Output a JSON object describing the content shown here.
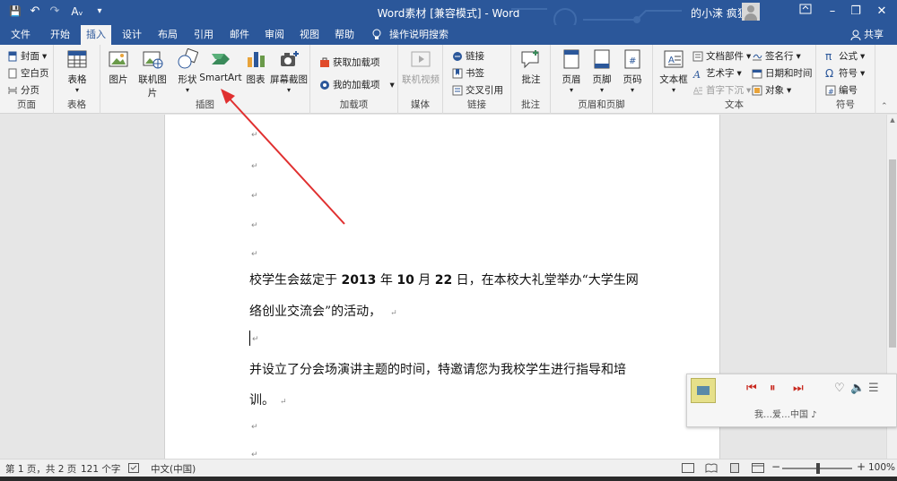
{
  "window": {
    "title": "Word素材 [兼容模式] - Word",
    "user": "的小涞 疯狂",
    "minimize_glyph": "–",
    "restore_glyph": "❐",
    "close_glyph": "✕"
  },
  "qat": {
    "save_glyph": "💾",
    "undo_glyph": "↶",
    "redo_glyph": "↷",
    "format_glyph": "Aᵥ",
    "more_glyph": "▾"
  },
  "tabs": [
    "文件",
    "开始",
    "插入",
    "设计",
    "布局",
    "引用",
    "邮件",
    "审阅",
    "视图",
    "帮助",
    "操作说明搜索"
  ],
  "share": "共享",
  "ribbon": {
    "pages": {
      "label": "页面",
      "cover": "封面",
      "blank": "空白页",
      "break": "分页"
    },
    "tables": {
      "label": "表格",
      "table": "表格"
    },
    "illustrations": {
      "label": "插图",
      "picture": "图片",
      "online_picture": "联机图片",
      "shapes": "形状",
      "smartart": "SmartArt",
      "chart": "图表",
      "screenshot": "屏幕截图"
    },
    "addins": {
      "label": "加载项",
      "get": "获取加载项",
      "mine": "我的加载项"
    },
    "media": {
      "label": "媒体",
      "video": "联机视频"
    },
    "links": {
      "label": "链接",
      "link": "链接",
      "bookmark": "书签",
      "crossref": "交叉引用"
    },
    "comments": {
      "label": "批注",
      "comment": "批注"
    },
    "header_footer": {
      "label": "页眉和页脚",
      "header": "页眉",
      "footer": "页脚",
      "page_number": "页码"
    },
    "text": {
      "label": "文本",
      "textbox": "文本框",
      "quickparts": "文档部件",
      "wordart": "艺术字",
      "dropcap": "首字下沉",
      "signature": "签名行",
      "datetime": "日期和时间",
      "object": "对象"
    },
    "symbols": {
      "label": "符号",
      "equation": "公式",
      "symbol": "符号",
      "number": "编号"
    }
  },
  "document": {
    "paragraph_mark": "↵",
    "line1_a": "校学生会兹定于 ",
    "line1_b": "2013",
    "line1_c": " 年 ",
    "line1_d": "10",
    "line1_e": " 月 ",
    "line1_f": "22",
    "line1_g": " 日，在本校大礼堂举办“大学生网",
    "line2": "络创业交流会”的活动，",
    "line3": "并设立了分会场演讲主题的时间，特邀请您为我校学生进行指导和培",
    "line4": "训。"
  },
  "statusbar": {
    "page": "第 1 页，共 2 页",
    "words": "121 个字",
    "language": "中文(中国)",
    "zoom": "100%",
    "zoom_minus": "−",
    "zoom_plus": "+"
  },
  "player": {
    "prev": "⏮",
    "pause": "⏸",
    "next": "⏭",
    "heart": "♡",
    "volume": "🔈",
    "list": "☰",
    "caption": "我…爱…中国 ♪"
  },
  "colors": {
    "brand": "#2b579a",
    "arrow": "#e03030"
  }
}
